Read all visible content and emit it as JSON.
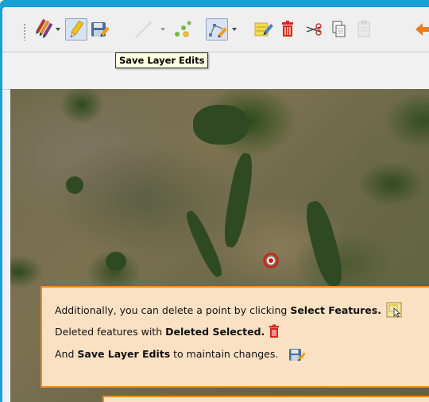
{
  "toolbar": {
    "buttons": [
      {
        "name": "current-edits",
        "icon": "multi-pencil-icon"
      },
      {
        "name": "toggle-editing",
        "icon": "pencil-icon",
        "active": true
      },
      {
        "name": "save-layer-edits",
        "icon": "save-layer-edits-icon"
      },
      {
        "name": "digitize-line",
        "icon": "line-digitize-icon",
        "disabled": true
      },
      {
        "name": "add-point-feature",
        "icon": "add-point-icon"
      },
      {
        "name": "vertex-tool",
        "icon": "vertex-tool-icon",
        "active": true
      },
      {
        "name": "modify-attributes",
        "icon": "edit-attributes-icon"
      },
      {
        "name": "delete-selected",
        "icon": "trash-icon"
      },
      {
        "name": "cut-features",
        "icon": "scissors-icon"
      },
      {
        "name": "copy-features",
        "icon": "copy-icon"
      },
      {
        "name": "paste-features",
        "icon": "paste-icon",
        "disabled": true
      },
      {
        "name": "undo",
        "icon": "undo-arrow-icon"
      }
    ]
  },
  "tooltip": {
    "text": "Save Layer Edits"
  },
  "note": {
    "line1_pre": "Additionally, you can delete a point by clicking ",
    "line1_bold": "Select Features.",
    "line2_pre": "Deleted features with ",
    "line2_bold": "Deleted Selected.",
    "line3_pre": "And ",
    "line3_bold": "Save Layer Edits",
    "line3_post": " to maintain changes."
  },
  "colors": {
    "frame": "#1aa0d8",
    "note_bg": "#fbe1c4",
    "note_border": "#f28a1f",
    "delete_red": "#d9261c",
    "target_red": "#cc1e1e"
  }
}
